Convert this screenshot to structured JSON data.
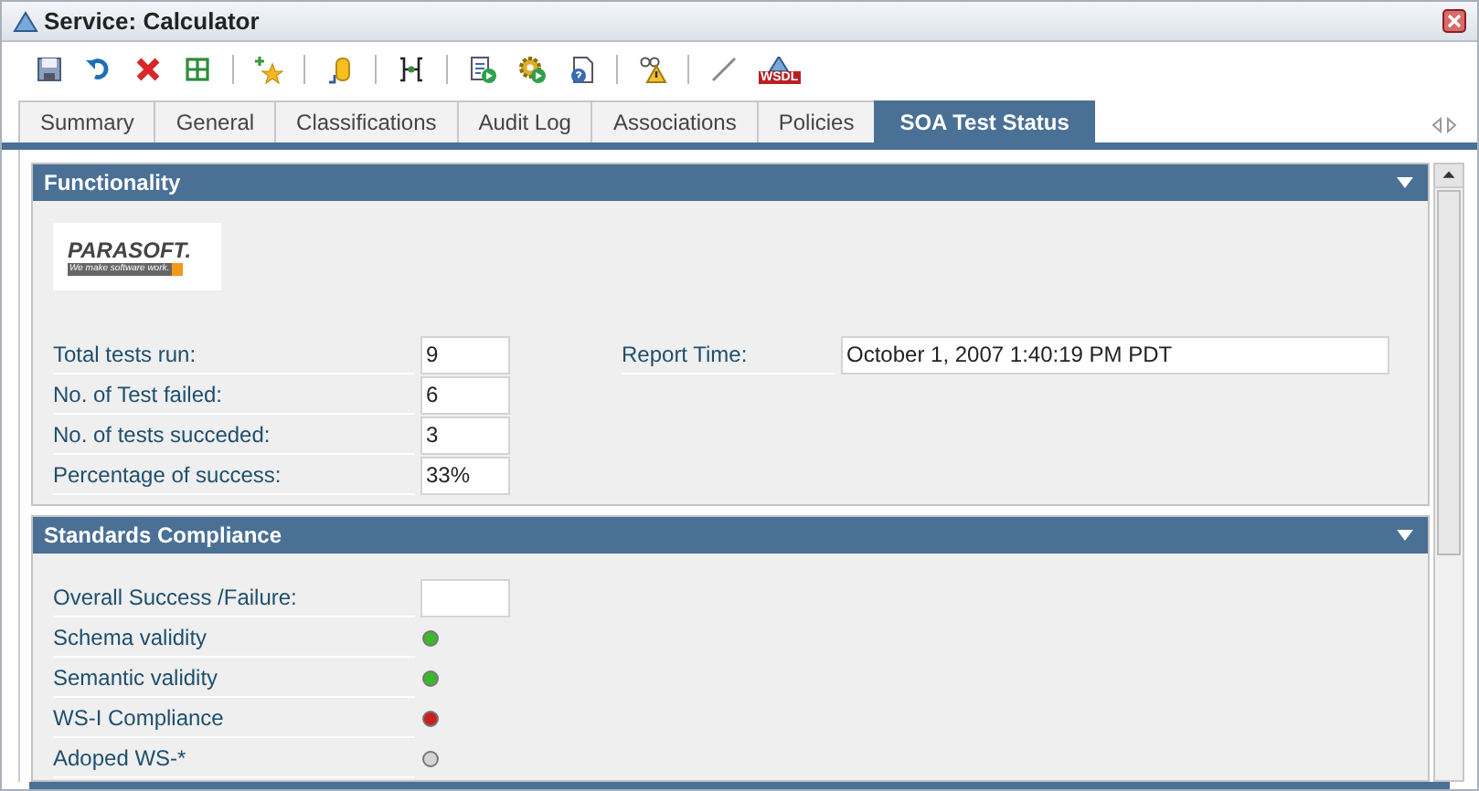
{
  "window": {
    "title": "Service: Calculator"
  },
  "toolbar": [
    {
      "kind": "save"
    },
    {
      "kind": "undo"
    },
    {
      "kind": "delete"
    },
    {
      "kind": "grid"
    },
    {
      "kind": "separator"
    },
    {
      "kind": "star"
    },
    {
      "kind": "separator"
    },
    {
      "kind": "cylinder"
    },
    {
      "kind": "separator"
    },
    {
      "kind": "branch"
    },
    {
      "kind": "separator"
    },
    {
      "kind": "doc-run"
    },
    {
      "kind": "gear-run"
    },
    {
      "kind": "doc-help"
    },
    {
      "kind": "separator"
    },
    {
      "kind": "warning"
    },
    {
      "kind": "separator"
    },
    {
      "kind": "line"
    },
    {
      "kind": "wsdl",
      "label": "WSDL"
    }
  ],
  "tabs": [
    {
      "label": "Summary",
      "selected": false
    },
    {
      "label": "General",
      "selected": false
    },
    {
      "label": "Classifications",
      "selected": false
    },
    {
      "label": "Audit Log",
      "selected": false
    },
    {
      "label": "Associations",
      "selected": false
    },
    {
      "label": "Policies",
      "selected": false
    },
    {
      "label": "SOA Test Status",
      "selected": true
    }
  ],
  "functionality": {
    "title": "Functionality",
    "expanded": true,
    "logo": {
      "name": "PARASOFT.",
      "tagline": "We make software work."
    },
    "rows": [
      {
        "label": "Total tests run:",
        "value": "9"
      },
      {
        "label": "No. of Test failed:",
        "value": "6"
      },
      {
        "label": "No. of tests succeded:",
        "value": "3"
      },
      {
        "label": "Percentage of success:",
        "value": "33%"
      }
    ],
    "report_time": {
      "label": "Report Time:",
      "value": "October 1, 2007 1:40:19 PM PDT"
    }
  },
  "standards": {
    "title": "Standards Compliance",
    "expanded": true,
    "rows": [
      {
        "kind": "field",
        "label": "Overall Success /Failure:"
      },
      {
        "kind": "status",
        "label": "Schema validity",
        "color": "#3cb82c"
      },
      {
        "kind": "status",
        "label": "Semantic validity",
        "color": "#3cb82c"
      },
      {
        "kind": "status",
        "label": "WS-I Compliance",
        "color": "#c8201e"
      },
      {
        "kind": "status",
        "label": "Adoped WS-*",
        "color": "#d4d4d4"
      }
    ]
  }
}
